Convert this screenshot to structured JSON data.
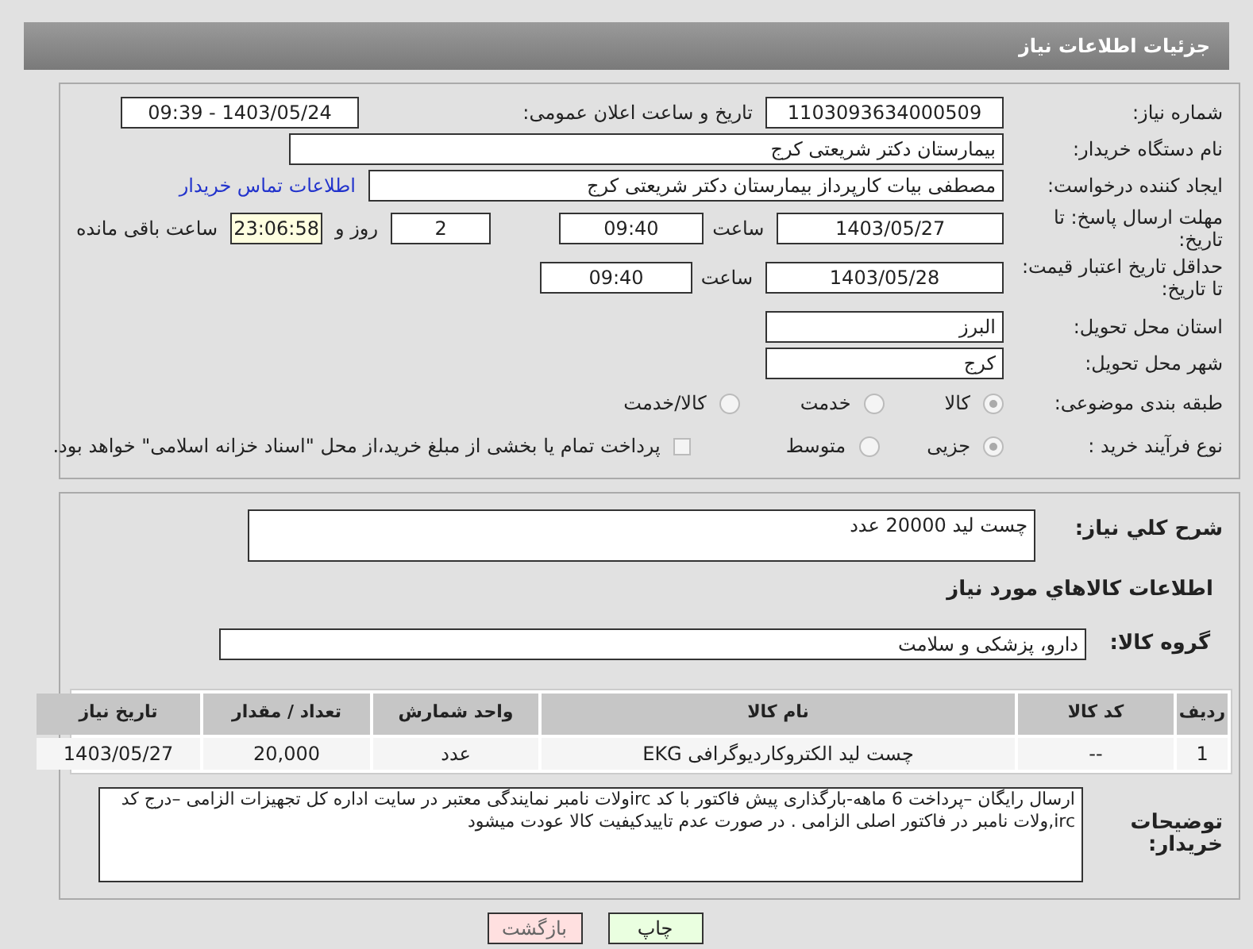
{
  "header": {
    "title": "جزئیات اطلاعات نیاز"
  },
  "need_number": {
    "label": "شماره نیاز:",
    "value": "1103093634000509"
  },
  "announce": {
    "label": "تاریخ و ساعت اعلان عمومی:",
    "value": "1403/05/24 - 09:39"
  },
  "buyer": {
    "label": "نام دستگاه خریدار:",
    "value": "بیمارستان دکتر شریعتی کرج"
  },
  "creator": {
    "label": "ایجاد کننده درخواست:",
    "value": "مصطفی بیات کارپرداز بیمارستان دکتر شریعتی کرج",
    "link": "اطلاعات تماس خریدار"
  },
  "deadline": {
    "label": "مهلت ارسال پاسخ: تا تاریخ:",
    "date": "1403/05/27",
    "time_label": "ساعت",
    "time": "09:40",
    "days": "2",
    "days_label": "روز و",
    "remaining": "23:06:58",
    "remaining_label": "ساعت باقی مانده"
  },
  "validity": {
    "label": "حداقل تاریخ اعتبار قیمت: تا تاریخ:",
    "date": "1403/05/28",
    "time_label": "ساعت",
    "time": "09:40"
  },
  "province": {
    "label": "استان محل تحویل:",
    "value": "البرز"
  },
  "city": {
    "label": "شهر محل تحویل:",
    "value": "کرج"
  },
  "category": {
    "label": "طبقه بندی موضوعی:",
    "options": [
      {
        "label": "کالا",
        "selected": true
      },
      {
        "label": "خدمت",
        "selected": false
      },
      {
        "label": "کالا/خدمت",
        "selected": false
      }
    ]
  },
  "process": {
    "label": "نوع فرآیند خرید :",
    "options": [
      {
        "label": "جزیی",
        "selected": true
      },
      {
        "label": "متوسط",
        "selected": false
      }
    ],
    "checkbox": {
      "label": "پرداخت تمام یا بخشی از مبلغ خرید،از محل \"اسناد خزانه اسلامی\" خواهد بود.",
      "checked": false
    }
  },
  "summary": {
    "label": "شرح کلي نياز:",
    "value": "چست لید 20000 عدد"
  },
  "goods_title": "اطلاعات کالاهاي مورد نياز",
  "group": {
    "label": "گروه کالا:",
    "value": "دارو، پزشکی و سلامت"
  },
  "table": {
    "columns": [
      "ردیف",
      "کد کالا",
      "نام کالا",
      "واحد شمارش",
      "تعداد / مقدار",
      "تاریخ نیاز"
    ],
    "rows": [
      [
        "1",
        "--",
        "چست لید الکتروکاردیوگرافی EKG",
        "عدد",
        "20,000",
        "1403/05/27"
      ]
    ]
  },
  "notes": {
    "label": "توضیحات خریدار:",
    "value": "ارسال رایگان –پرداخت 6 ماهه-بارگذاری  پیش فاکتور با کد ircولات نامبر نمایندگی معتبر در سایت اداره کل تجهیزات الزامی –درج کد irc,ولات نامبر در فاکتور اصلی الزامی . در صورت عدم تاییدکیفیت کالا عودت میشود"
  },
  "buttons": [
    {
      "label": "چاپ",
      "kind": "print"
    },
    {
      "label": "بازگشت",
      "kind": "back"
    }
  ]
}
